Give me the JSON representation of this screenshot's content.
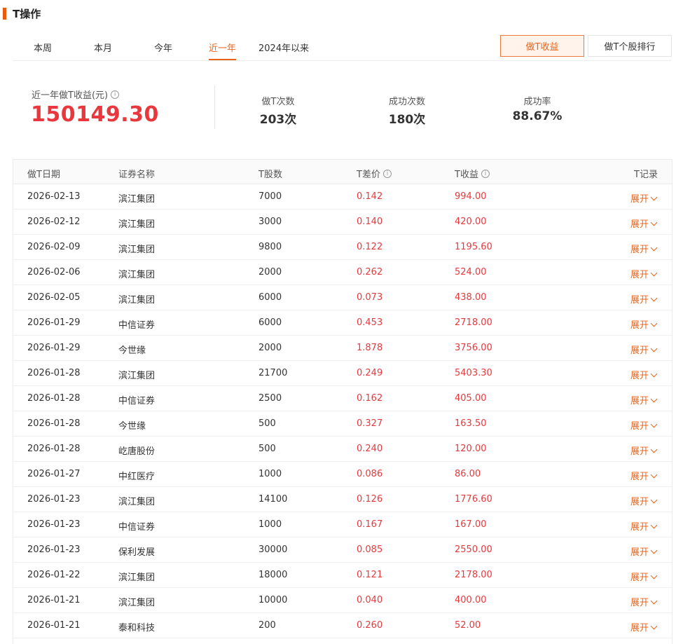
{
  "section": {
    "title": "T操作"
  },
  "tabs": [
    "本周",
    "本月",
    "今年",
    "近一年",
    "2024年以来"
  ],
  "active_tab": 3,
  "buttons": {
    "income": "做T收益",
    "ranking": "做T个股排行"
  },
  "summary": {
    "label": "近一年做T收益(元)",
    "value": "150149.30",
    "stats": [
      {
        "label": "做T次数",
        "value": "203次"
      },
      {
        "label": "成功次数",
        "value": "180次"
      },
      {
        "label": "成功率",
        "value": "88.67%"
      }
    ]
  },
  "table": {
    "headers": {
      "date": "做T日期",
      "name": "证券名称",
      "qty": "T股数",
      "diff": "T差价",
      "income": "T收益",
      "record": "T记录"
    },
    "expand_label": "展开",
    "rows": [
      {
        "date": "2026-02-13",
        "name": "滨江集团",
        "qty": "7000",
        "diff": "0.142",
        "income": "994.00"
      },
      {
        "date": "2026-02-12",
        "name": "滨江集团",
        "qty": "3000",
        "diff": "0.140",
        "income": "420.00"
      },
      {
        "date": "2026-02-09",
        "name": "滨江集团",
        "qty": "9800",
        "diff": "0.122",
        "income": "1195.60"
      },
      {
        "date": "2026-02-06",
        "name": "滨江集团",
        "qty": "2000",
        "diff": "0.262",
        "income": "524.00"
      },
      {
        "date": "2026-02-05",
        "name": "滨江集团",
        "qty": "6000",
        "diff": "0.073",
        "income": "438.00"
      },
      {
        "date": "2026-01-29",
        "name": "中信证券",
        "qty": "6000",
        "diff": "0.453",
        "income": "2718.00"
      },
      {
        "date": "2026-01-29",
        "name": "今世缘",
        "qty": "2000",
        "diff": "1.878",
        "income": "3756.00"
      },
      {
        "date": "2026-01-28",
        "name": "滨江集团",
        "qty": "21700",
        "diff": "0.249",
        "income": "5403.30"
      },
      {
        "date": "2026-01-28",
        "name": "中信证券",
        "qty": "2500",
        "diff": "0.162",
        "income": "405.00"
      },
      {
        "date": "2026-01-28",
        "name": "今世缘",
        "qty": "500",
        "diff": "0.327",
        "income": "163.50"
      },
      {
        "date": "2026-01-28",
        "name": "屹唐股份",
        "qty": "500",
        "diff": "0.240",
        "income": "120.00"
      },
      {
        "date": "2026-01-27",
        "name": "中红医疗",
        "qty": "1000",
        "diff": "0.086",
        "income": "86.00"
      },
      {
        "date": "2026-01-23",
        "name": "滨江集团",
        "qty": "14100",
        "diff": "0.126",
        "income": "1776.60"
      },
      {
        "date": "2026-01-23",
        "name": "中信证券",
        "qty": "1000",
        "diff": "0.167",
        "income": "167.00"
      },
      {
        "date": "2026-01-23",
        "name": "保利发展",
        "qty": "30000",
        "diff": "0.085",
        "income": "2550.00"
      },
      {
        "date": "2026-01-22",
        "name": "滨江集团",
        "qty": "18000",
        "diff": "0.121",
        "income": "2178.00"
      },
      {
        "date": "2026-01-21",
        "name": "滨江集团",
        "qty": "10000",
        "diff": "0.040",
        "income": "400.00"
      },
      {
        "date": "2026-01-21",
        "name": "泰和科技",
        "qty": "200",
        "diff": "0.260",
        "income": "52.00"
      }
    ]
  },
  "colors": {
    "accent": "#e8641b",
    "positive": "#e8383d"
  },
  "icons": {
    "info": "info-circle-icon",
    "expand": "chevron-down-icon"
  }
}
